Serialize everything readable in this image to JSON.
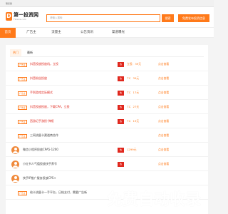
{
  "topbar": {
    "text": "联系我"
  },
  "header": {
    "logo_mark": "D",
    "logo_title": "第一投资网",
    "logo_sub": "Flowce.com",
    "search_placeholder": "请输入搜索",
    "search_button": "搜索",
    "publish_button": "免费发布投资信息",
    "accent_color": "#ff7a1a"
  },
  "nav": [
    {
      "label": "首页",
      "active": true
    },
    {
      "label": "广告主",
      "active": false
    },
    {
      "label": "流量主",
      "active": false
    },
    {
      "label": "公告资讯",
      "active": false
    },
    {
      "label": "渠道曝光",
      "active": false
    }
  ],
  "subtabs": [
    {
      "label": "热门",
      "active": true
    },
    {
      "label": "最新",
      "active": false
    }
  ],
  "rows": [
    {
      "kind": "badge",
      "badge": "广告主",
      "title": "抖音投放投放机，立投",
      "tag": "热",
      "price": "立投：39元",
      "action": "点击查看"
    },
    {
      "kind": "badge",
      "badge": "广告主",
      "title": "抖音粉丝投放",
      "tag": "热",
      "price": "T1：39元",
      "action": "点击查看"
    },
    {
      "kind": "badge",
      "badge": "广告主",
      "title": "手到游戏实际模式",
      "tag": "热",
      "price": "T1：17元",
      "action": "点击查看"
    },
    {
      "kind": "badge",
      "badge": "广告主",
      "title": "抖音投放投放，下载CPA，立投",
      "tag": "热",
      "price": "T1：27元",
      "action": "点击查看"
    },
    {
      "kind": "badge",
      "badge": "广告主",
      "title": "西游记手游投-弹框",
      "tag": "热",
      "price": "T1：19元",
      "action": "点击查看"
    },
    {
      "kind": "badge",
      "badge": "广告主",
      "title": "三网流量卡渠道商合作",
      "tag": "",
      "price": "",
      "action": "点击查看"
    },
    {
      "kind": "user",
      "title": "微信小程序投放CPA5-1200",
      "tag": "热",
      "price": "1299元",
      "action": "点击查看"
    },
    {
      "kind": "user",
      "title": "小红书人气值投放快手养号",
      "tag": "热",
      "price": "",
      "action": "点击查看"
    },
    {
      "kind": "user",
      "title": "快手IP推广服务投放CPS+",
      "tag": "",
      "price": "",
      "action": ""
    },
    {
      "kind": "badge",
      "badge": "广告主",
      "title": "给卡流量卡一手平台，日结支付，需要广告新",
      "tag": "",
      "price": "",
      "action": ""
    }
  ],
  "watermark": "免费自动收录"
}
